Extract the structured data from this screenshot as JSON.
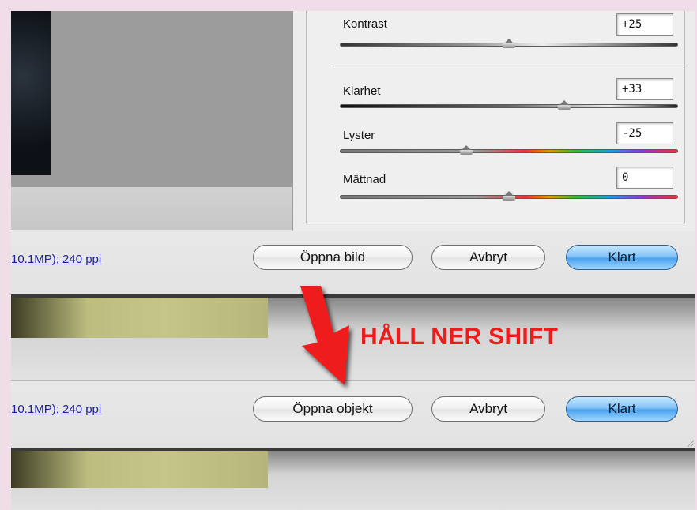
{
  "adjustments": {
    "sliders": [
      {
        "label": "Kontrast",
        "value": "+25",
        "level": 0.5,
        "track": "gray"
      },
      {
        "label": "Klarhet",
        "value": "+33",
        "level": 0.66,
        "track": "dark"
      },
      {
        "label": "Lyster",
        "value": "-25",
        "level": 0.38,
        "track": "color"
      },
      {
        "label": "Mättnad",
        "value": "0",
        "level": 0.5,
        "track": "color"
      }
    ]
  },
  "dialog_top": {
    "info_link": "10.1MP); 240 ppi",
    "open_button": "Öppna bild",
    "cancel_button": "Avbryt",
    "done_button": "Klart"
  },
  "dialog_bottom": {
    "info_link": "10.1MP); 240 ppi",
    "open_button": "Öppna objekt",
    "cancel_button": "Avbryt",
    "done_button": "Klart"
  },
  "annotation": {
    "text": "HÅLL NER SHIFT",
    "color": "#ee1b1b"
  },
  "colors": {
    "default_button": "#4ba2ee",
    "link": "#1a1aa8"
  }
}
